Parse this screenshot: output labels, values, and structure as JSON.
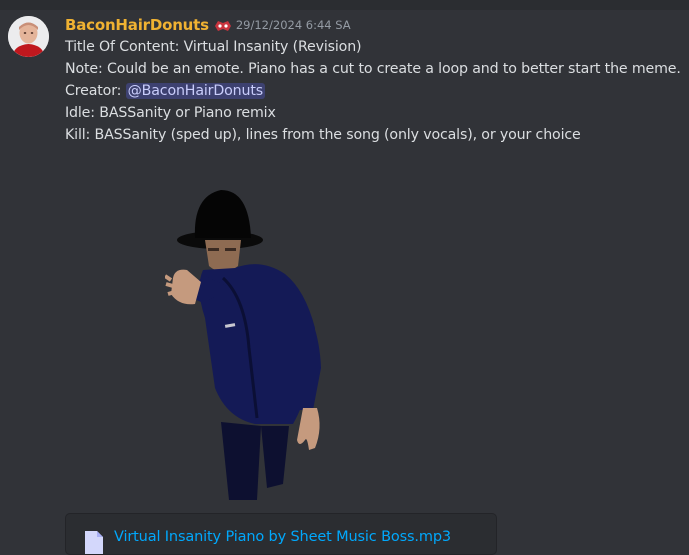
{
  "message": {
    "username": "BaconHairDonuts",
    "timestamp": "29/12/2024 6:44 SA",
    "lines": {
      "title": "Title Of Content: Virtual Insanity (Revision)",
      "note": "Note: Could be an emote. Piano has a cut to create a loop and to better start the meme.",
      "creator_prefix": "Creator: ",
      "creator_mention": "@BaconHairDonuts",
      "idle": "Idle: BASSanity or Piano remix",
      "kill": "Kill: BASSanity (sped up), lines from the song (only vocals), or your choice"
    },
    "attachment": {
      "filename": "Virtual Insanity Piano by Sheet Music Boss.mp3",
      "icon": "file-audio-icon"
    }
  },
  "colors": {
    "background": "#313338",
    "username": "#f0b232",
    "text": "#dbdee1",
    "timestamp": "#949ba4",
    "link": "#00a8fc",
    "mention_text": "#c9cdfb"
  }
}
